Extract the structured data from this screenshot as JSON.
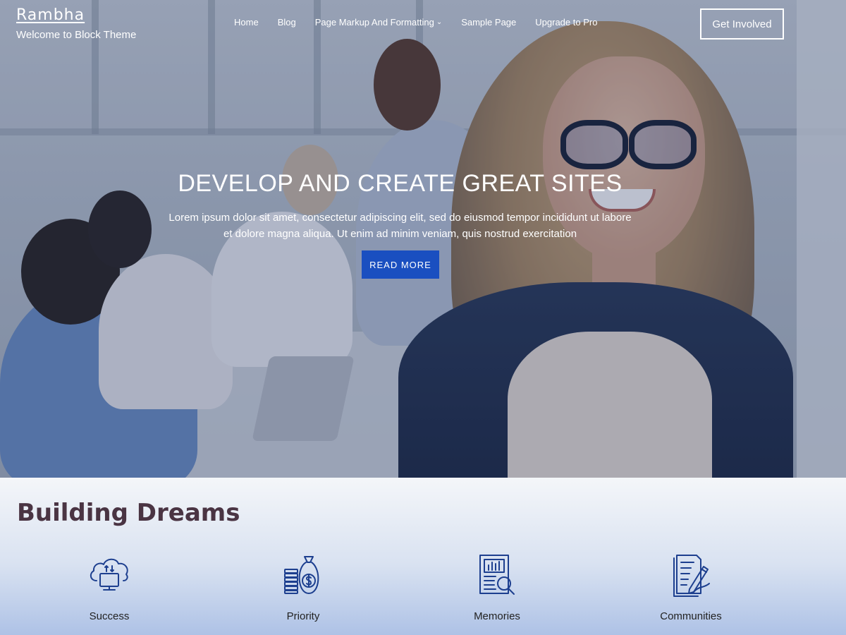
{
  "site": {
    "title": "Rambha",
    "tagline": "Welcome to Block Theme"
  },
  "nav": {
    "items": [
      {
        "label": "Home"
      },
      {
        "label": "Blog"
      },
      {
        "label": "Page Markup And Formatting",
        "has_dropdown": true
      },
      {
        "label": "Sample Page"
      },
      {
        "label": "Upgrade to Pro"
      }
    ],
    "cta_label": "Get Involved"
  },
  "hero": {
    "title": "DEVELOP AND CREATE GREAT SITES",
    "text": "Lorem ipsum dolor sit amet, consectetur adipiscing elit, sed do eiusmod tempor incididunt ut labore et dolore magna aliqua. Ut enim ad minim veniam, quis nostrud exercitation",
    "button_label": "READ MORE",
    "button_color": "#1a4fc0"
  },
  "features": {
    "title": "Building Dreams",
    "items": [
      {
        "label": "Success",
        "icon": "cloud-computer-icon"
      },
      {
        "label": "Priority",
        "icon": "money-bag-icon"
      },
      {
        "label": "Memories",
        "icon": "report-magnifier-icon"
      },
      {
        "label": "Communities",
        "icon": "document-pen-icon"
      }
    ]
  },
  "colors": {
    "heading": "#4a3443",
    "icon_stroke": "#1d3f8f",
    "accent": "#1a4fc0"
  }
}
